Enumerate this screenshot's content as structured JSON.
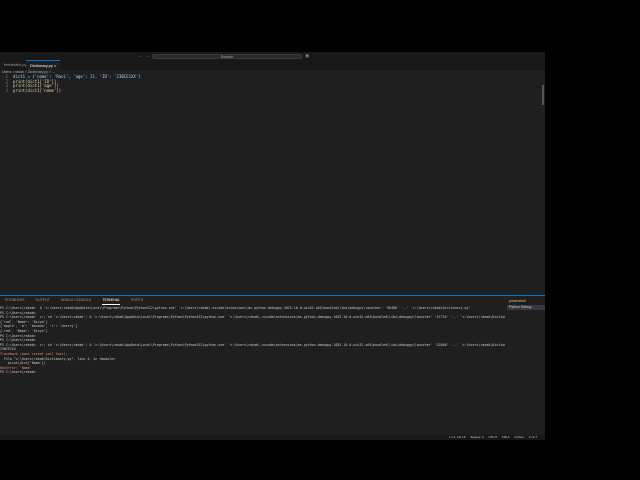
{
  "titlebar": {
    "search": "Search"
  },
  "tabs": [
    {
      "label": "thedetails.py"
    },
    {
      "label": "Dictionary.py"
    }
  ],
  "breadcrumb": "Users > rakab > Dictionary.py > ...",
  "code": [
    {
      "n": "1",
      "text": "dict1 = {'name': 'Ravi', 'age': 21, 'ID': '23BCE1XX'}"
    },
    {
      "n": "2",
      "text": "print(dict1['ID'])"
    },
    {
      "n": "3",
      "text": "print(dict1['age'])"
    },
    {
      "n": "4",
      "text": "print(dict1['name'])"
    }
  ],
  "panel": {
    "tabs": [
      "PROBLEMS",
      "OUTPUT",
      "DEBUG CONSOLE",
      "TERMINAL",
      "PORTS"
    ],
    "active": "TERMINAL"
  },
  "terminal": [
    "PS C:\\Users\\rakab>  & 'c:\\Users\\rakab\\AppData\\Local\\Programs\\Python\\Python312\\python.exe' 'c:\\Users\\rakab\\.vscode\\extensions\\ms-python.debugpy-2025.10.0-win32-x64\\bundled\\libs\\debugpy\\launcher' '56486' '--' 'c:\\Users\\rakab\\Dictionary.py'",
    "PS C:\\Users\\rakab> ",
    "PS C:\\Users\\rakab>  c:; cd 'c:\\Users\\rakab'; & 'c:\\Users\\rakab\\AppData\\Local\\Programs\\Python\\Python312\\python.exe' 'c:\\Users\\rakab\\.vscode\\extensions\\ms-python.debugpy-2025.10.0-win32-x64\\bundled\\libs\\debugpy\\launcher' '57734' '--' 'c:\\Users\\rakab\\Dictionary.py'",
    "{'red', 'Name': 'Divya'}",
    "{'apple', 'b': 'banana', 'c': 'cherry'}",
    "{'red', 'Name': 'Divya'}",
    "PS C:\\Users\\rakab> ",
    "PS C:\\Users\\rakab> ",
    "PS C:\\Users\\rakab>  c:; cd 'c:\\Users\\rakab'; & 'c:\\Users\\rakab\\AppData\\Local\\Programs\\Python\\Python312\\python.exe' 'c:\\Users\\rakab\\.vscode\\extensions\\ms-python.debugpy-2025.10.0-win32-x64\\bundled\\libs\\debugpy\\launcher' '52048' '--' 'c:\\Users\\rakab\\Dictionary.py'",
    "23BCE1XX",
    "",
    "Traceback (most recent call last):",
    "  File \"c:\\Users\\rakab\\Dictionary.py\", line 4, in <module>",
    "    print(dict['Name'])",
    "",
    "KeyError: 'Name'",
    "PS C:\\Users\\rakab> "
  ],
  "terminal_list": [
    "powershell",
    "Python Debug..."
  ],
  "status": {
    "pos": "Ln 4, Col 16",
    "spaces": "Spaces: 4",
    "enc": "UTF-8",
    "eol": "CRLF",
    "lang": "Python",
    "ver": "3.12.7"
  }
}
